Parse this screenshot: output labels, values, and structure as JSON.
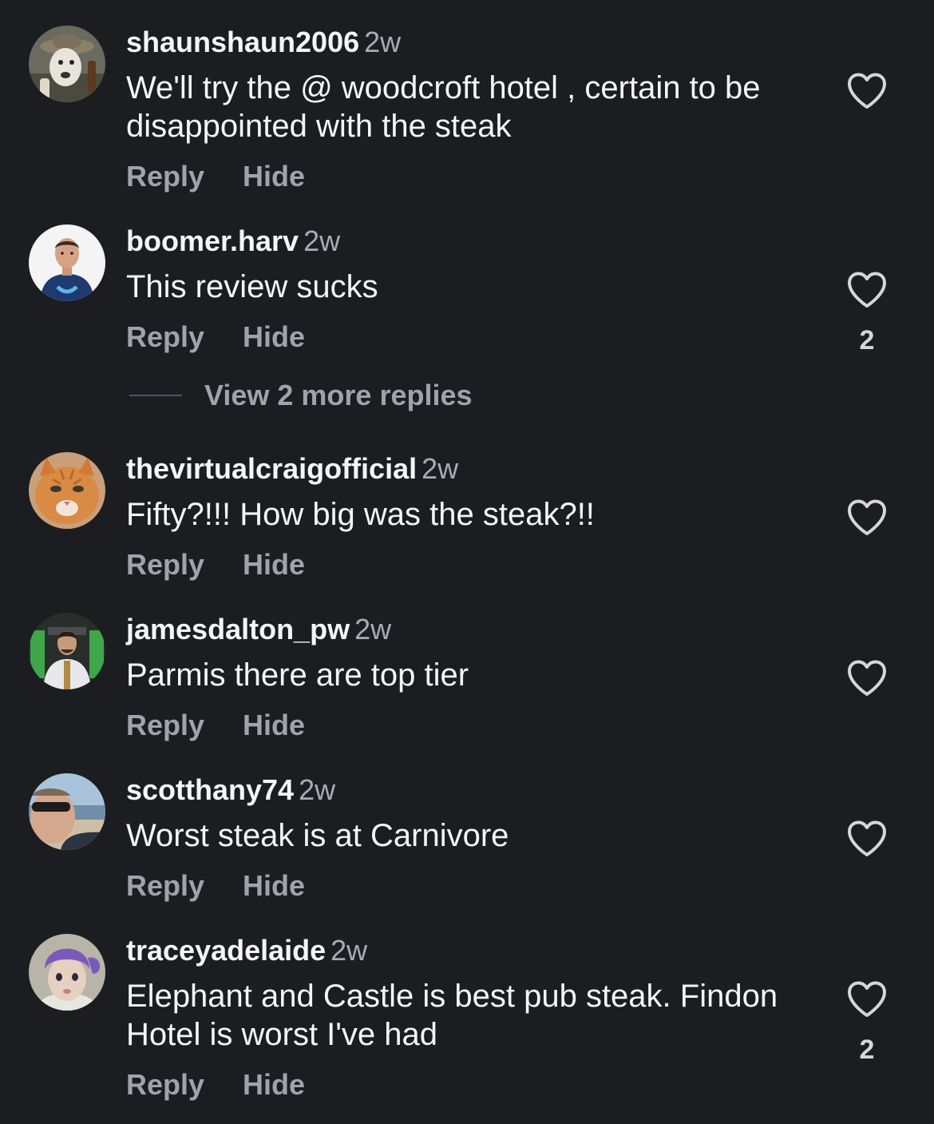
{
  "comments": [
    {
      "username": "shaunshaun2006",
      "time": "2w",
      "text": "We'll try the @ woodcroft hotel , certain to be disappointed with the steak",
      "reply_label": "Reply",
      "hide_label": "Hide",
      "like_count": "",
      "avatar_icon": "bull-terrier-with-hat-avatar"
    },
    {
      "username": "boomer.harv",
      "time": "2w",
      "text": "This review sucks",
      "reply_label": "Reply",
      "hide_label": "Hide",
      "like_count": "2",
      "avatar_icon": "man-in-jersey-avatar",
      "view_replies_label": "View 2 more replies"
    },
    {
      "username": "thevirtualcraigofficial",
      "time": "2w",
      "text": "Fifty?!!! How big was the steak?!!",
      "reply_label": "Reply",
      "hide_label": "Hide",
      "like_count": "",
      "avatar_icon": "orange-cat-avatar"
    },
    {
      "username": "jamesdalton_pw",
      "time": "2w",
      "text": "Parmis there are top tier",
      "reply_label": "Reply",
      "hide_label": "Hide",
      "like_count": "",
      "avatar_icon": "man-in-white-jacket-avatar"
    },
    {
      "username": "scotthany74",
      "time": "2w",
      "text": "Worst steak is at Carnivore",
      "reply_label": "Reply",
      "hide_label": "Hide",
      "like_count": "",
      "avatar_icon": "man-with-sunglasses-beach-avatar"
    },
    {
      "username": "traceyadelaide",
      "time": "2w",
      "text": "Elephant and Castle is best pub steak. Findon Hotel is worst I've had",
      "reply_label": "Reply",
      "hide_label": "Hide",
      "like_count": "2",
      "avatar_icon": "child-with-purple-hair-avatar"
    }
  ],
  "colors": {
    "background": "#1b1d21",
    "text_primary": "#f3f5f7",
    "text_secondary": "#a0a3a8",
    "icon": "#d4d6da"
  },
  "icons": {
    "like": "heart-outline-icon"
  }
}
